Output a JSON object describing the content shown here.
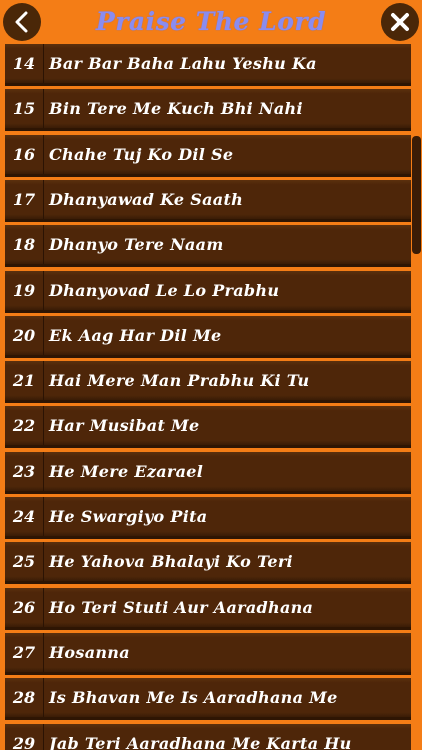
{
  "header": {
    "title": "Praise The Lord",
    "back_icon": "chevron-left-icon",
    "close_icon": "close-icon"
  },
  "songs": [
    {
      "num": "14",
      "title": "Bar Bar Baha Lahu Yeshu Ka"
    },
    {
      "num": "15",
      "title": "Bin Tere Me Kuch Bhi Nahi"
    },
    {
      "num": "16",
      "title": "Chahe Tuj Ko Dil Se"
    },
    {
      "num": "17",
      "title": "Dhanyawad Ke Saath"
    },
    {
      "num": "18",
      "title": "Dhanyo Tere Naam"
    },
    {
      "num": "19",
      "title": "Dhanyovad Le Lo Prabhu"
    },
    {
      "num": "20",
      "title": "Ek Aag Har Dil Me"
    },
    {
      "num": "21",
      "title": "Hai Mere Man Prabhu Ki Tu"
    },
    {
      "num": "22",
      "title": "Har Musibat Me"
    },
    {
      "num": "23",
      "title": "He Mere Ezarael"
    },
    {
      "num": "24",
      "title": "He Swargiyo Pita"
    },
    {
      "num": "25",
      "title": "He Yahova Bhalayi Ko Teri"
    },
    {
      "num": "26",
      "title": "Ho Teri Stuti Aur Aaradhana"
    },
    {
      "num": "27",
      "title": "Hosanna"
    },
    {
      "num": "28",
      "title": "Is Bhavan Me Is Aaradhana Me"
    },
    {
      "num": "29",
      "title": "Jab Teri Aaradhana Me Karta Hu"
    }
  ],
  "colors": {
    "background": "#f47d16",
    "row": "#4e2609",
    "title": "#8a8cf0",
    "text": "#ffffff"
  }
}
